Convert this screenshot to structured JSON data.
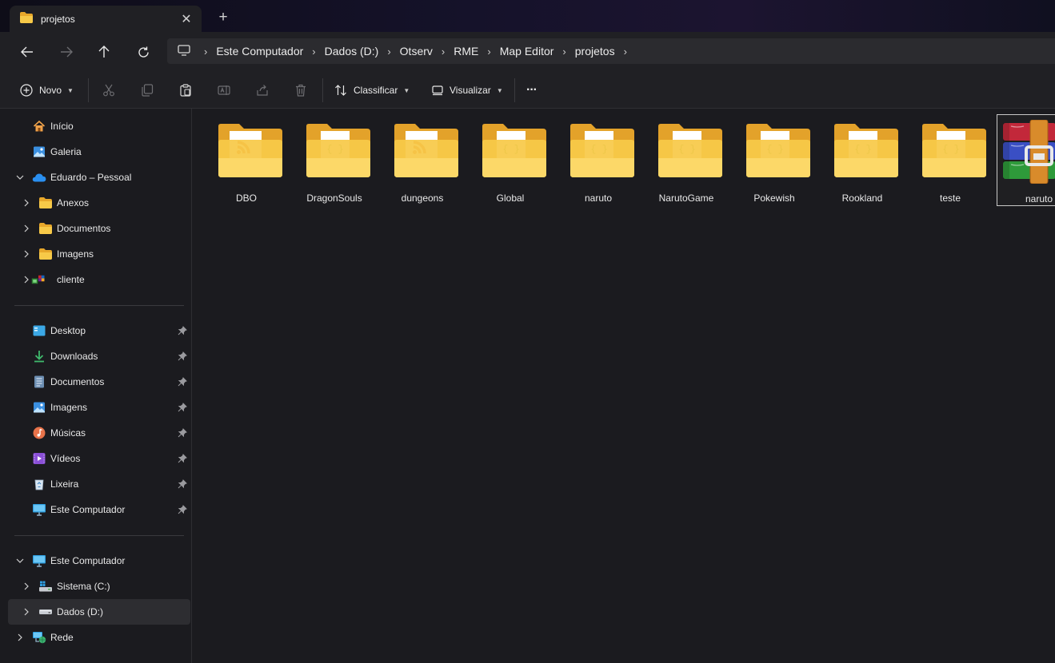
{
  "tab": {
    "title": "projetos",
    "close_glyph": "✕",
    "new_tab_glyph": "+"
  },
  "breadcrumbs": [
    "Este Computador",
    "Dados (D:)",
    "Otserv",
    "RME",
    "Map Editor",
    "projetos"
  ],
  "toolbar": {
    "new_label": "Novo",
    "sort_label": "Classificar",
    "view_label": "Visualizar",
    "more_glyph": "···"
  },
  "sidebar": {
    "quick": [
      {
        "label": "Início",
        "icon": "home-icon"
      },
      {
        "label": "Galeria",
        "icon": "gallery-icon"
      },
      {
        "label": "Eduardo – Pessoal",
        "icon": "onedrive-icon"
      },
      {
        "label": "Anexos",
        "icon": "folder-icon"
      },
      {
        "label": "Documentos",
        "icon": "folder-icon"
      },
      {
        "label": "Imagens",
        "icon": "folder-icon"
      },
      {
        "label": "cliente",
        "icon": "app-icon"
      }
    ],
    "pinned": [
      {
        "label": "Desktop",
        "icon": "desktop-icon"
      },
      {
        "label": "Downloads",
        "icon": "download-icon"
      },
      {
        "label": "Documentos",
        "icon": "documents-icon"
      },
      {
        "label": "Imagens",
        "icon": "pictures-icon"
      },
      {
        "label": "Músicas",
        "icon": "music-icon"
      },
      {
        "label": "Vídeos",
        "icon": "videos-icon"
      },
      {
        "label": "Lixeira",
        "icon": "recycle-bin-icon"
      },
      {
        "label": "Este Computador",
        "icon": "computer-icon"
      }
    ],
    "tree": [
      {
        "label": "Este Computador",
        "icon": "computer-icon"
      },
      {
        "label": "Sistema (C:)",
        "icon": "drive-c-icon"
      },
      {
        "label": "Dados (D:)",
        "icon": "drive-d-icon"
      },
      {
        "label": "Rede",
        "icon": "network-icon"
      }
    ]
  },
  "files": [
    {
      "name": "DBO",
      "type": "folder",
      "overlay": "rss"
    },
    {
      "name": "DragonSouls",
      "type": "folder",
      "overlay": "code"
    },
    {
      "name": "dungeons",
      "type": "folder",
      "overlay": "rss"
    },
    {
      "name": "Global",
      "type": "folder",
      "overlay": "code"
    },
    {
      "name": "naruto",
      "type": "folder",
      "overlay": "code"
    },
    {
      "name": "NarutoGame",
      "type": "folder",
      "overlay": "code"
    },
    {
      "name": "Pokewish",
      "type": "folder",
      "overlay": "code"
    },
    {
      "name": "Rookland",
      "type": "folder",
      "overlay": "code"
    },
    {
      "name": "teste",
      "type": "folder",
      "overlay": "code"
    },
    {
      "name": "naruto",
      "type": "archive",
      "overlay": ""
    }
  ],
  "colors": {
    "accent": "#60cdff",
    "folder": "#f7c948",
    "folder_back": "#e8a82b"
  }
}
